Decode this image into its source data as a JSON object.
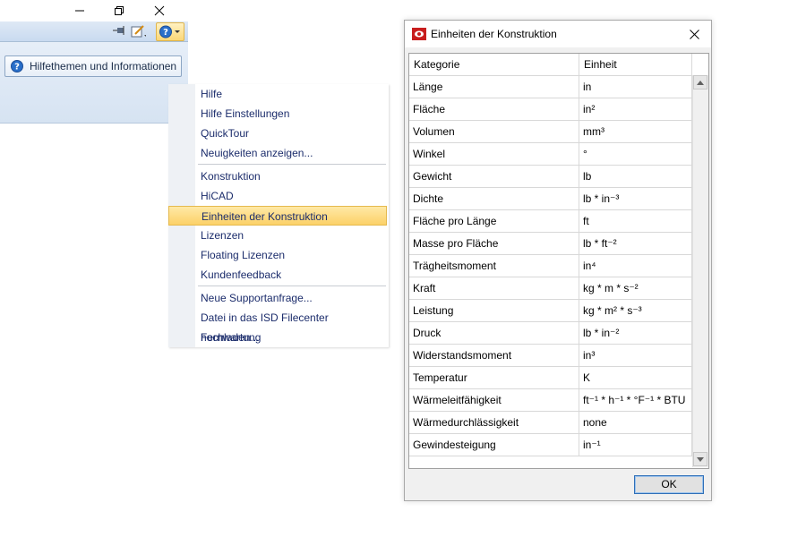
{
  "app": {
    "hilfe_button_label": "Hilfethemen und Informationen",
    "icons": [
      "minimize-icon",
      "restore-icon",
      "close-icon",
      "pin-icon",
      "edit-icon",
      "help-icon"
    ]
  },
  "menu": {
    "items": [
      {
        "label": "Hilfe"
      },
      {
        "label": "Hilfe Einstellungen"
      },
      {
        "label": "QuickTour"
      },
      {
        "label": "Neuigkeiten anzeigen..."
      },
      {
        "label": "Konstruktion"
      },
      {
        "label": "HiCAD"
      },
      {
        "label": "Einheiten der Konstruktion",
        "highlighted": true
      },
      {
        "label": "Lizenzen"
      },
      {
        "label": "Floating Lizenzen"
      },
      {
        "label": "Kundenfeedback"
      },
      {
        "label": "Neue Supportanfrage..."
      },
      {
        "label": "Datei in das ISD Filecenter hochladen..."
      },
      {
        "label": "Fernwartung"
      }
    ]
  },
  "dialog": {
    "title": "Einheiten der Konstruktion",
    "columns": [
      "Kategorie",
      "Einheit"
    ],
    "rows": [
      [
        "Länge",
        "in"
      ],
      [
        "Fläche",
        "in²"
      ],
      [
        "Volumen",
        "mm³"
      ],
      [
        "Winkel",
        "°"
      ],
      [
        "Gewicht",
        "lb"
      ],
      [
        "Dichte",
        "lb * in⁻³"
      ],
      [
        "Fläche pro Länge",
        "ft"
      ],
      [
        "Masse pro Fläche",
        "lb * ft⁻²"
      ],
      [
        "Trägheitsmoment",
        "in⁴"
      ],
      [
        "Kraft",
        "kg * m * s⁻²"
      ],
      [
        "Leistung",
        "kg * m² * s⁻³"
      ],
      [
        "Druck",
        "lb * in⁻²"
      ],
      [
        "Widerstandsmoment",
        "in³"
      ],
      [
        "Temperatur",
        "K"
      ],
      [
        "Wärmeleitfähigkeit",
        "ft⁻¹ * h⁻¹ * °F⁻¹ * BTU"
      ],
      [
        "Wärmedurchlässigkeit",
        "none"
      ],
      [
        "Gewindesteigung",
        "in⁻¹"
      ]
    ],
    "ok_label": "OK"
  },
  "colors": {
    "menu_text": "#1b2c6b",
    "menu_highlight": "#fcd168",
    "ok_border": "#2f6fb8"
  }
}
